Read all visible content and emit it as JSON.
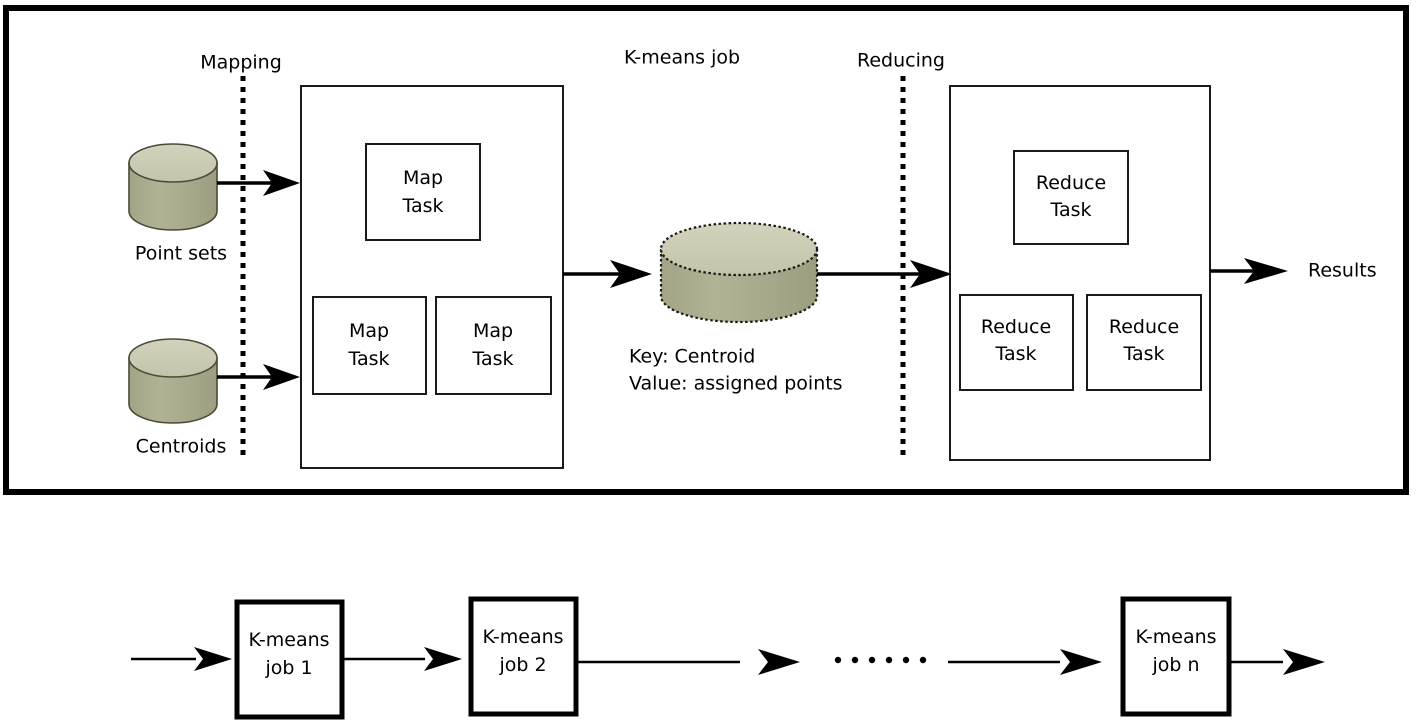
{
  "figure": {
    "title_top": "K-means job",
    "phases": {
      "mapping": "Mapping",
      "reducing": "Reducing"
    },
    "sources": [
      {
        "id": "point-sets",
        "label": "Point sets"
      },
      {
        "id": "centroids",
        "label": "Centroids"
      }
    ],
    "map_stage": {
      "tasks": [
        {
          "line1": "Map",
          "line2": "Task"
        },
        {
          "line1": "Map",
          "line2": "Task"
        },
        {
          "line1": "Map",
          "line2": "Task"
        }
      ]
    },
    "intermediate_store": {
      "annotation_line1": "Key: Centroid",
      "annotation_line2": "Value: assigned points"
    },
    "reduce_stage": {
      "tasks": [
        {
          "line1": "Reduce",
          "line2": "Task"
        },
        {
          "line1": "Reduce",
          "line2": "Task"
        },
        {
          "line1": "Reduce",
          "line2": "Task"
        }
      ]
    },
    "output": {
      "label": "Results"
    },
    "job_chain": {
      "jobs": [
        {
          "line1": "K-means",
          "line2": "job 1"
        },
        {
          "line1": "K-means",
          "line2": "job 2"
        },
        {
          "line1": "K-means",
          "line2": "job n"
        }
      ],
      "ellipsis": "......"
    }
  },
  "colors": {
    "cylinder_top": "#cdcdb4",
    "cylinder_body": "#a9a98c",
    "cylinder_outline": "#4a4a38",
    "stroke": "#000000",
    "box_fill": "#ffffff",
    "background": "#ffffff"
  }
}
